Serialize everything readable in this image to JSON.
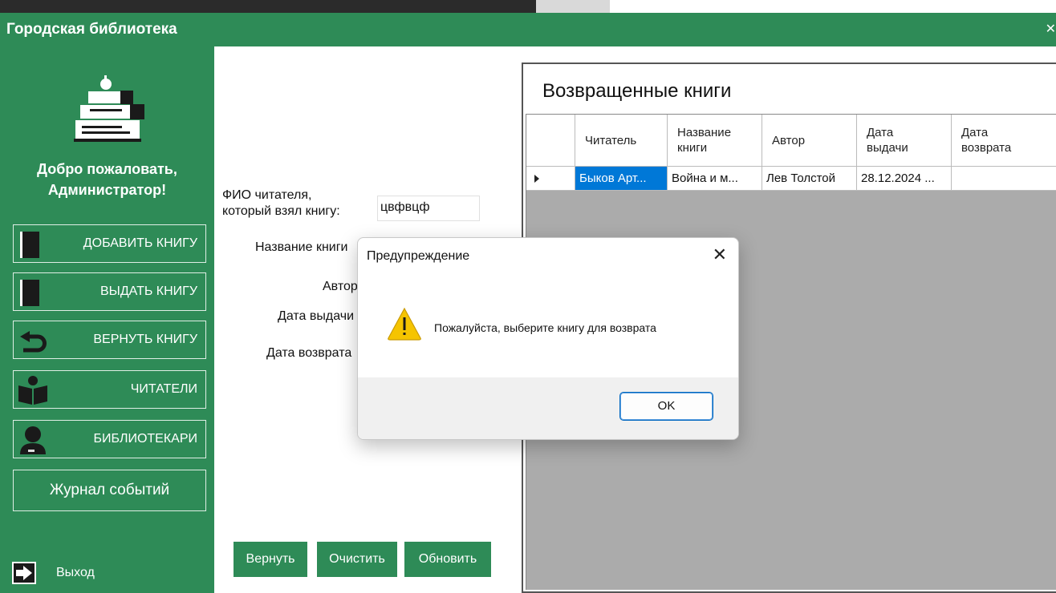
{
  "window": {
    "title": "Городская библиотека",
    "close_glyph": "✕"
  },
  "sidebar": {
    "welcome_line1": "Добро пожаловать,",
    "welcome_line2": "Администратор!",
    "items": [
      {
        "label": "ДОБАВИТЬ КНИГУ",
        "icon": "book-icon"
      },
      {
        "label": "ВЫДАТЬ КНИГУ",
        "icon": "book-icon"
      },
      {
        "label": "ВЕРНУТЬ КНИГУ",
        "icon": "return-arrow-icon"
      },
      {
        "label": "ЧИТАТЕЛИ",
        "icon": "reader-icon"
      },
      {
        "label": "БИБЛИОТЕКАРИ",
        "icon": "person-icon"
      },
      {
        "label": "Журнал событий",
        "icon": ""
      }
    ],
    "exit_label": "Выход"
  },
  "form": {
    "fio_label_line1": "ФИО читателя,",
    "fio_label_line2": "который взял книгу:",
    "fio_value": "цвфвцф",
    "book_label": "Название книги",
    "author_label": "Автор",
    "issue_date_label": "Дата выдачи",
    "return_date_label": "Дата возврата",
    "buttons": {
      "return": "Вернуть",
      "clear": "Очистить",
      "refresh": "Обновить"
    }
  },
  "returned_panel": {
    "title": "Возвращенные книги",
    "columns": [
      [
        "Читатель"
      ],
      [
        "Название",
        "книги"
      ],
      [
        "Автор"
      ],
      [
        "Дата",
        "выдачи"
      ],
      [
        "Дата",
        "возврата"
      ]
    ],
    "rows": [
      [
        "Быков Арт...",
        "Война и м...",
        "Лев Толстой",
        "28.12.2024 ...",
        ""
      ]
    ]
  },
  "dialog": {
    "title": "Предупреждение",
    "message": "Пожалуйста, выберите книгу для возврата",
    "ok_label": "OK",
    "close_glyph": "✕"
  },
  "colors": {
    "accent": "#2e8b57",
    "selection": "#0078d7",
    "warning": "#f5c400"
  }
}
